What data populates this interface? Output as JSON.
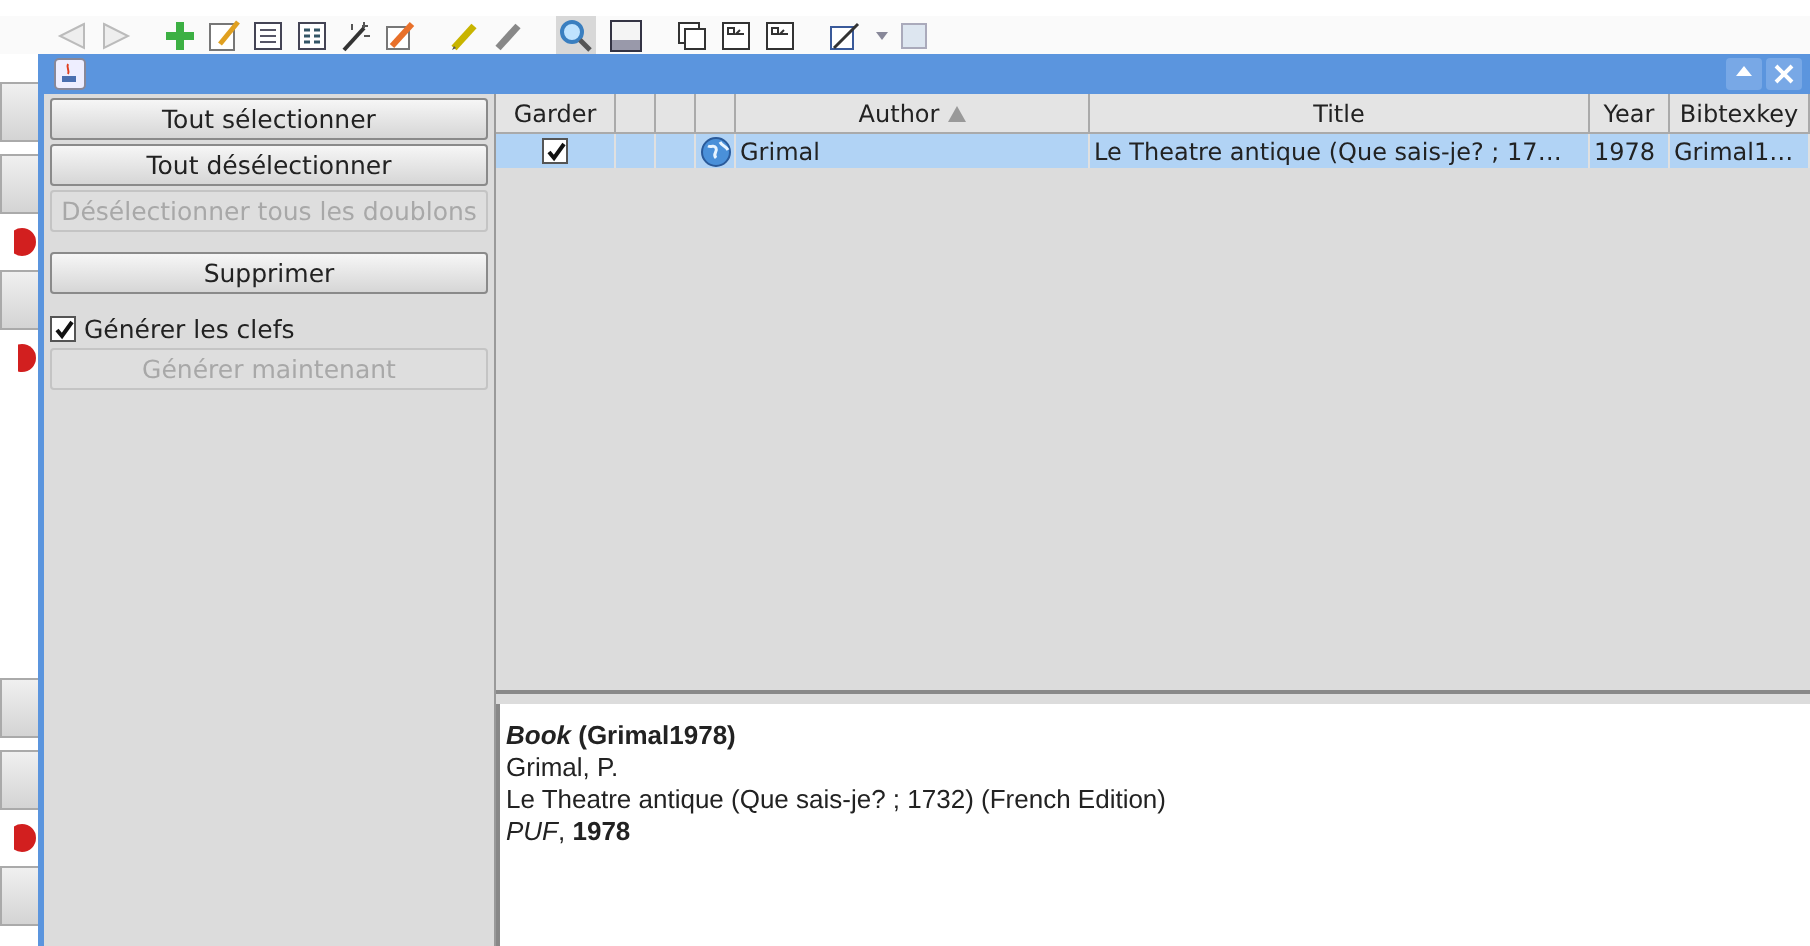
{
  "dialog": {
    "buttons": [
      {
        "label": "Tout sélectionner",
        "disabled": false
      },
      {
        "label": "Tout désélectionner",
        "disabled": false
      },
      {
        "label": "Désélectionner tous les doublons",
        "disabled": true
      },
      {
        "label": "Supprimer",
        "disabled": false
      }
    ],
    "generate_keys": {
      "label": "Générer les clefs",
      "checked": true
    },
    "generate_now": {
      "label": "Générer maintenant",
      "disabled": true
    }
  },
  "table": {
    "columns": [
      {
        "kind": "label",
        "label": "Garder",
        "sorted": false
      },
      {
        "kind": "blank"
      },
      {
        "kind": "blank"
      },
      {
        "kind": "blank"
      },
      {
        "kind": "label",
        "label": "Author",
        "sorted": true
      },
      {
        "kind": "label",
        "label": "Title",
        "sorted": false
      },
      {
        "kind": "label",
        "label": "Year",
        "sorted": false
      },
      {
        "kind": "label",
        "label": "Bibtexkey",
        "sorted": false
      }
    ],
    "rows": [
      {
        "selected": true,
        "keep": true,
        "author": "Grimal",
        "title": "Le Theatre antique (Que sais-je? ; 17…",
        "year": "1978",
        "bibtexkey": "Grimal1…"
      }
    ]
  },
  "preview": {
    "lines": [
      {
        "kind": "heading",
        "text": "*Book* (Grimal1978)"
      },
      {
        "kind": "plain",
        "text": "Grimal, P."
      },
      {
        "kind": "plain",
        "text": "Le Theatre antique (Que sais-je? ; 1732) (French Edition)"
      },
      {
        "kind": "plain",
        "text": "*PUF*, **1978**"
      }
    ]
  }
}
